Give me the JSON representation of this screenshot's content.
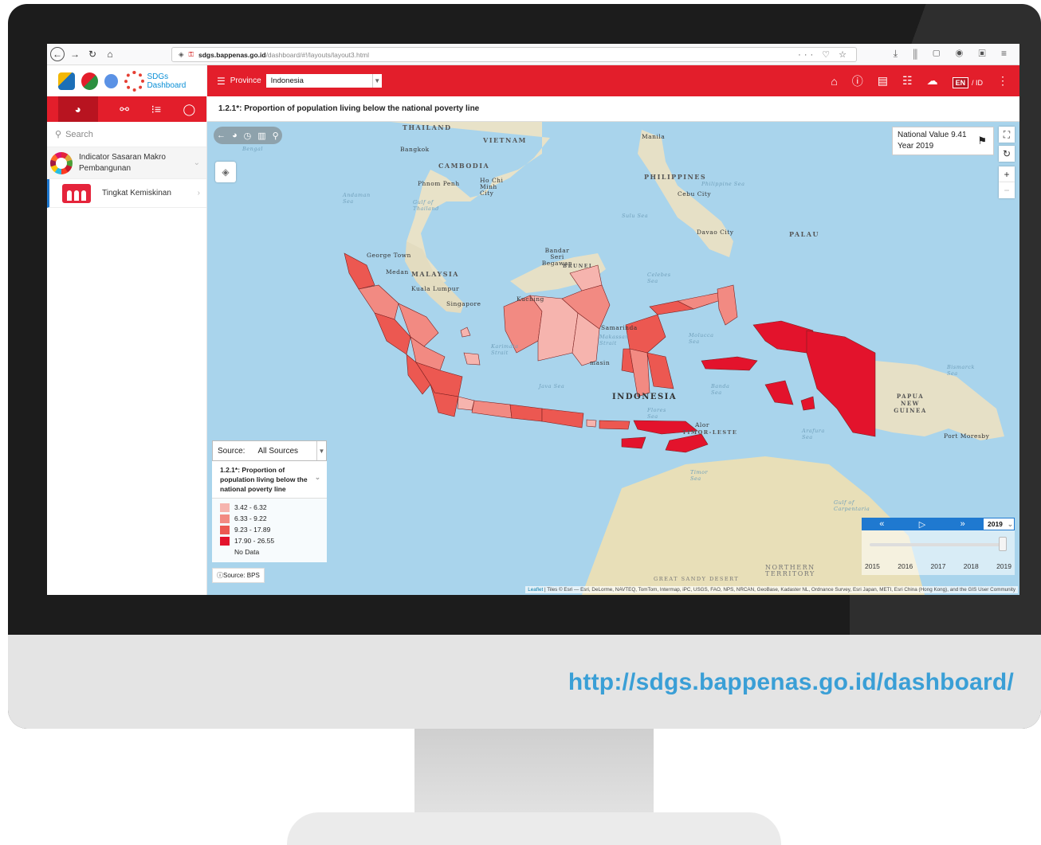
{
  "browser": {
    "url_prefix": "",
    "url_domain": "sdgs.bappenas.go.id",
    "url_path": "/dashboard/#!/layouts/layout3.html",
    "url_right_icons": "··· ♡ ☆",
    "tools_icons": "⤓ ⫼ ▢ ◉ ▣ ≡"
  },
  "app": {
    "sdgs_logo_text": "SDGs Dashboard",
    "province_label": "Province",
    "province_value": "Indonesia",
    "lang_en": "EN",
    "lang_id": "/ ID",
    "indicator_title": "1.2.1*: Proportion of population living below the national poverty line"
  },
  "sidebar": {
    "search_placeholder": "Search",
    "items": [
      {
        "label_line1": "Indicator Sasaran Makro",
        "label_line2": "Pembangunan",
        "icon": "sdg-wheel-icon"
      },
      {
        "label_line1": "Tingkat Kemiskinan",
        "icon": "poverty-icon"
      }
    ]
  },
  "map": {
    "national_value_label": "National Value 9.41",
    "year_label": "Year 2019",
    "labels": {
      "thailand": "THAILAND",
      "vietnam": "VIETNAM",
      "cambodia": "CAMBODIA",
      "philippines": "PHILIPPINES",
      "malaysia": "MALAYSIA",
      "brunei": "BRUNEI",
      "indonesia": "INDONESIA",
      "palau": "PALAU",
      "png": "PAPUA NEW GUINEA",
      "timor": "TIMOR-LESTE",
      "bangkok": "Bangkok",
      "manila": "Manila",
      "phnom_penh": "Phnom Penh",
      "hcmc": "Ho Chi Minh City",
      "cebu": "Cebu City",
      "davao": "Davao City",
      "george_town": "George Town",
      "medan": "Medan",
      "kuala_lumpur": "Kuala Lumpur",
      "singapore": "Singapore",
      "kuching": "Kuching",
      "bandar": "Bandar Seri Begawan",
      "port_moresby": "Port Moresby",
      "northern_territory": "NORTHERN TERRITORY",
      "great_sandy": "GREAT SANDY DESERT",
      "alor": "Alor",
      "samarinda": "Samarinda",
      "banjarmasin": "masin",
      "java_sea": "Java Sea",
      "andaman": "Andaman Sea",
      "gulf_thailand": "Gulf of Thailand",
      "philippine_sea": "Philippine Sea",
      "sulu_sea": "Sulu Sea",
      "celebes_sea": "Celebes Sea",
      "molucca_sea": "Molucca Sea",
      "banda_sea": "Banda Sea",
      "arafura": "Arafura Sea",
      "timor_sea": "Timor Sea",
      "flores_sea": "Flores Sea",
      "bismarck": "Bismarck Sea",
      "carpentaria": "Gulf of Carpentaria",
      "makassar": "Makassar Strait",
      "karimata": "Karimata Strait",
      "bengal": "Bengal"
    },
    "attribution_leaflet": "Leaflet",
    "attribution_text": "| Tiles © Esri — Esri, DeLorme, NAVTEQ, TomTom, Intermap, iPC, USGS, FAO, NPS, NRCAN, GeoBase, Kadaster NL, Ordnance Survey, Esri Japan, METI, Esri China (Hong Kong), and the GIS User Community"
  },
  "legend": {
    "source_label": "Source:",
    "source_value": "All Sources",
    "title": "1.2.1*: Proportion of population living below the national poverty line",
    "ranges": [
      {
        "label": "3.42 - 6.32",
        "color": "#f6b4ae"
      },
      {
        "label": "6.33 - 9.22",
        "color": "#f28a82"
      },
      {
        "label": "9.23 - 17.89",
        "color": "#ec5851"
      },
      {
        "label": "17.90 - 26.55",
        "color": "#e3132c"
      },
      {
        "label": "No Data",
        "color": ""
      }
    ],
    "source_badge": "Source: BPS"
  },
  "timeline": {
    "selected_year": "2019",
    "years": [
      "2015",
      "2016",
      "2017",
      "2018",
      "2019"
    ]
  },
  "caption": {
    "url": "http://sdgs.bappenas.go.id/dashboard/"
  },
  "colors": {
    "brand_red": "#e31e2b",
    "timeline_blue": "#1f79d0",
    "caption_blue": "#3a9fd6"
  }
}
